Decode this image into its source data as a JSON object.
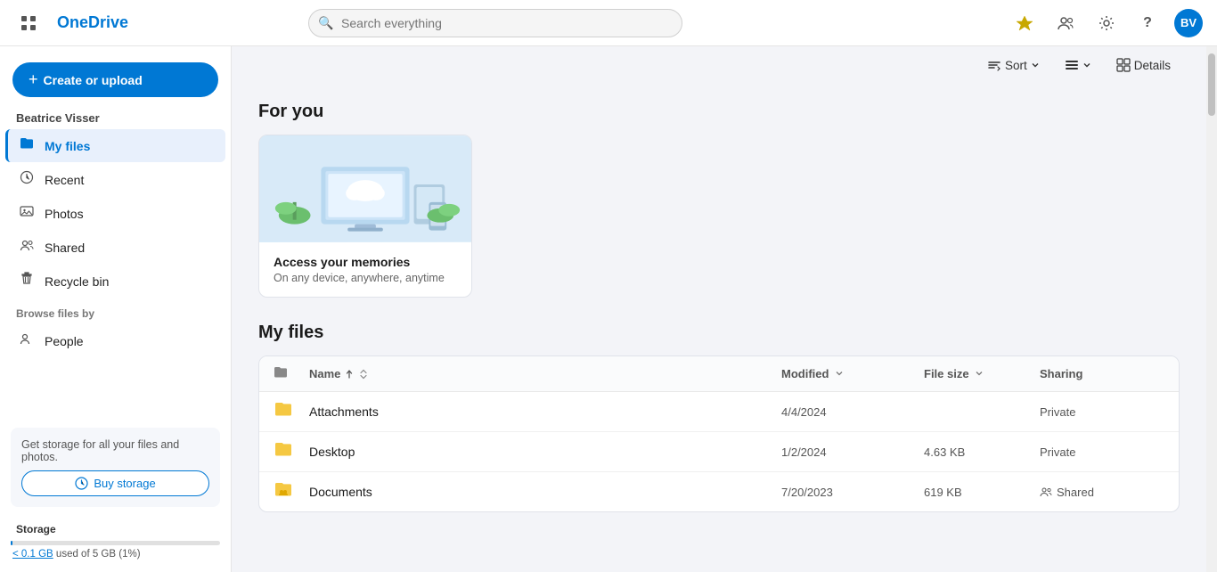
{
  "topbar": {
    "apps_label": "⊞",
    "brand": "OneDrive",
    "search_placeholder": "Search everything",
    "premium_icon": "👑",
    "share_icon": "👤",
    "settings_icon": "⚙",
    "help_icon": "?",
    "avatar_initials": "BV"
  },
  "sidebar": {
    "create_btn": "Create or upload",
    "user_name": "Beatrice Visser",
    "nav_items": [
      {
        "id": "my-files",
        "label": "My files",
        "icon": "📁",
        "active": true
      },
      {
        "id": "recent",
        "label": "Recent",
        "icon": "🕐",
        "active": false
      },
      {
        "id": "photos",
        "label": "Photos",
        "icon": "🖼",
        "active": false
      },
      {
        "id": "shared",
        "label": "Shared",
        "icon": "👥",
        "active": false
      },
      {
        "id": "recycle-bin",
        "label": "Recycle bin",
        "icon": "🗑",
        "active": false
      }
    ],
    "browse_section": "Browse files by",
    "people_item": "People",
    "storage_box": {
      "message": "Get storage for all your files and photos.",
      "buy_btn": "Buy storage"
    },
    "storage_label": "Storage",
    "storage_usage": "used of 5 GB (1%)",
    "storage_link": "< 0.1 GB"
  },
  "toolbar": {
    "sort_label": "Sort",
    "sort_icon": "↑↓",
    "view_icon": "☰",
    "details_label": "Details",
    "details_icon": "⊞"
  },
  "for_you": {
    "section_title": "For you",
    "cards": [
      {
        "title": "Access your memories",
        "subtitle": "On any device, anywhere, anytime"
      }
    ]
  },
  "my_files": {
    "section_title": "My files",
    "columns": {
      "name": "Name",
      "modified": "Modified",
      "file_size": "File size",
      "sharing": "Sharing"
    },
    "rows": [
      {
        "icon": "📁",
        "name": "Attachments",
        "modified": "4/4/2024",
        "file_size": "",
        "sharing": "Private",
        "sharing_icon": ""
      },
      {
        "icon": "📁",
        "name": "Desktop",
        "modified": "1/2/2024",
        "file_size": "4.63 KB",
        "sharing": "Private",
        "sharing_icon": ""
      },
      {
        "icon": "📁",
        "name": "Documents",
        "modified": "7/20/2023",
        "file_size": "619 KB",
        "sharing": "Shared",
        "sharing_icon": "👥"
      }
    ]
  }
}
